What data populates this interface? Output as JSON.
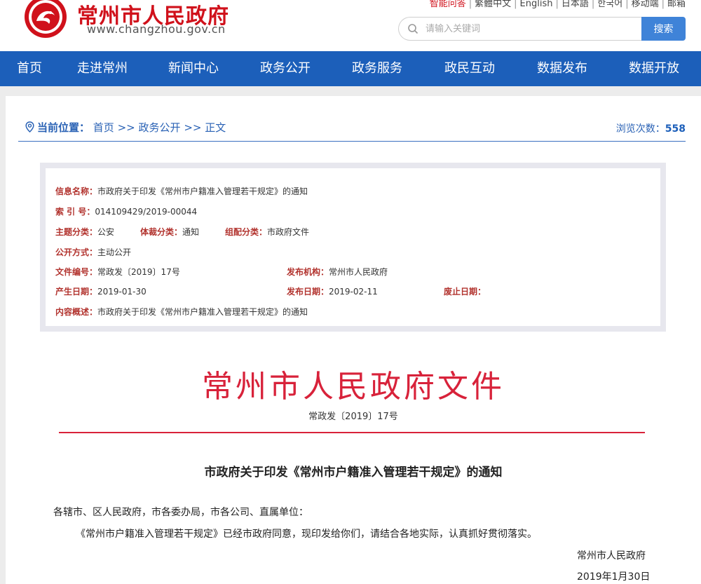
{
  "header": {
    "site_title": "常州市人民政府",
    "site_url": "www.changzhou.gov.cn",
    "top_links": [
      "智能问答",
      "繁體中文",
      "English",
      "日本語",
      "한국어",
      "移动端",
      "邮箱"
    ],
    "search": {
      "placeholder": "请输入关键词",
      "button_label": "搜索"
    }
  },
  "nav": {
    "items": [
      "首页",
      "走进常州",
      "新闻中心",
      "政务公开",
      "政务服务",
      "政民互动",
      "数据发布",
      "数据开放"
    ]
  },
  "breadcrumb": {
    "label": "当前位置：",
    "items": [
      "首页",
      "政务公开",
      "正文"
    ],
    "separator": ">>"
  },
  "views": {
    "label": "浏览次数：",
    "count": "558"
  },
  "info": {
    "name_label": "信息名称：",
    "name_value": "市政府关于印发《常州市户籍准入管理若干规定》的通知",
    "index_label": "索 引 号：",
    "index_value": "014109429/2019-00044",
    "topic_label": "主题分类：",
    "topic_value": "公安",
    "genre_label": "体裁分类：",
    "genre_value": "通知",
    "org_label": "组配分类：",
    "org_value": "市政府文件",
    "open_label": "公开方式：",
    "open_value": "主动公开",
    "docno_label": "文件编号：",
    "docno_value": "常政发〔2019〕17号",
    "publisher_label": "发布机构：",
    "publisher_value": "常州市人民政府",
    "created_label": "产生日期：",
    "created_value": "2019-01-30",
    "published_label": "发布日期：",
    "published_value": "2019-02-11",
    "expire_label": "废止日期：",
    "expire_value": "",
    "summary_label": "内容概述：",
    "summary_value": "市政府关于印发《常州市户籍准入管理若干规定》的通知"
  },
  "document": {
    "red_title": "常州市人民政府文件",
    "number": "常政发〔2019〕17号",
    "notice_title": "市政府关于印发《常州市户籍准入管理若干规定》的通知",
    "salutation": "各辖市、区人民政府，市各委办局，市各公司、直属单位：",
    "body": "《常州市户籍准入管理若干规定》已经市政府同意，现印发给你们，请结合各地实际，认真抓好贯彻落实。",
    "signature": "常州市人民政府",
    "date": "2019年1月30日"
  },
  "colors": {
    "brand_red": "#d0111b",
    "nav_blue": "#1c5fba",
    "link_blue": "#2a62b5",
    "doc_red": "#d8223a"
  }
}
